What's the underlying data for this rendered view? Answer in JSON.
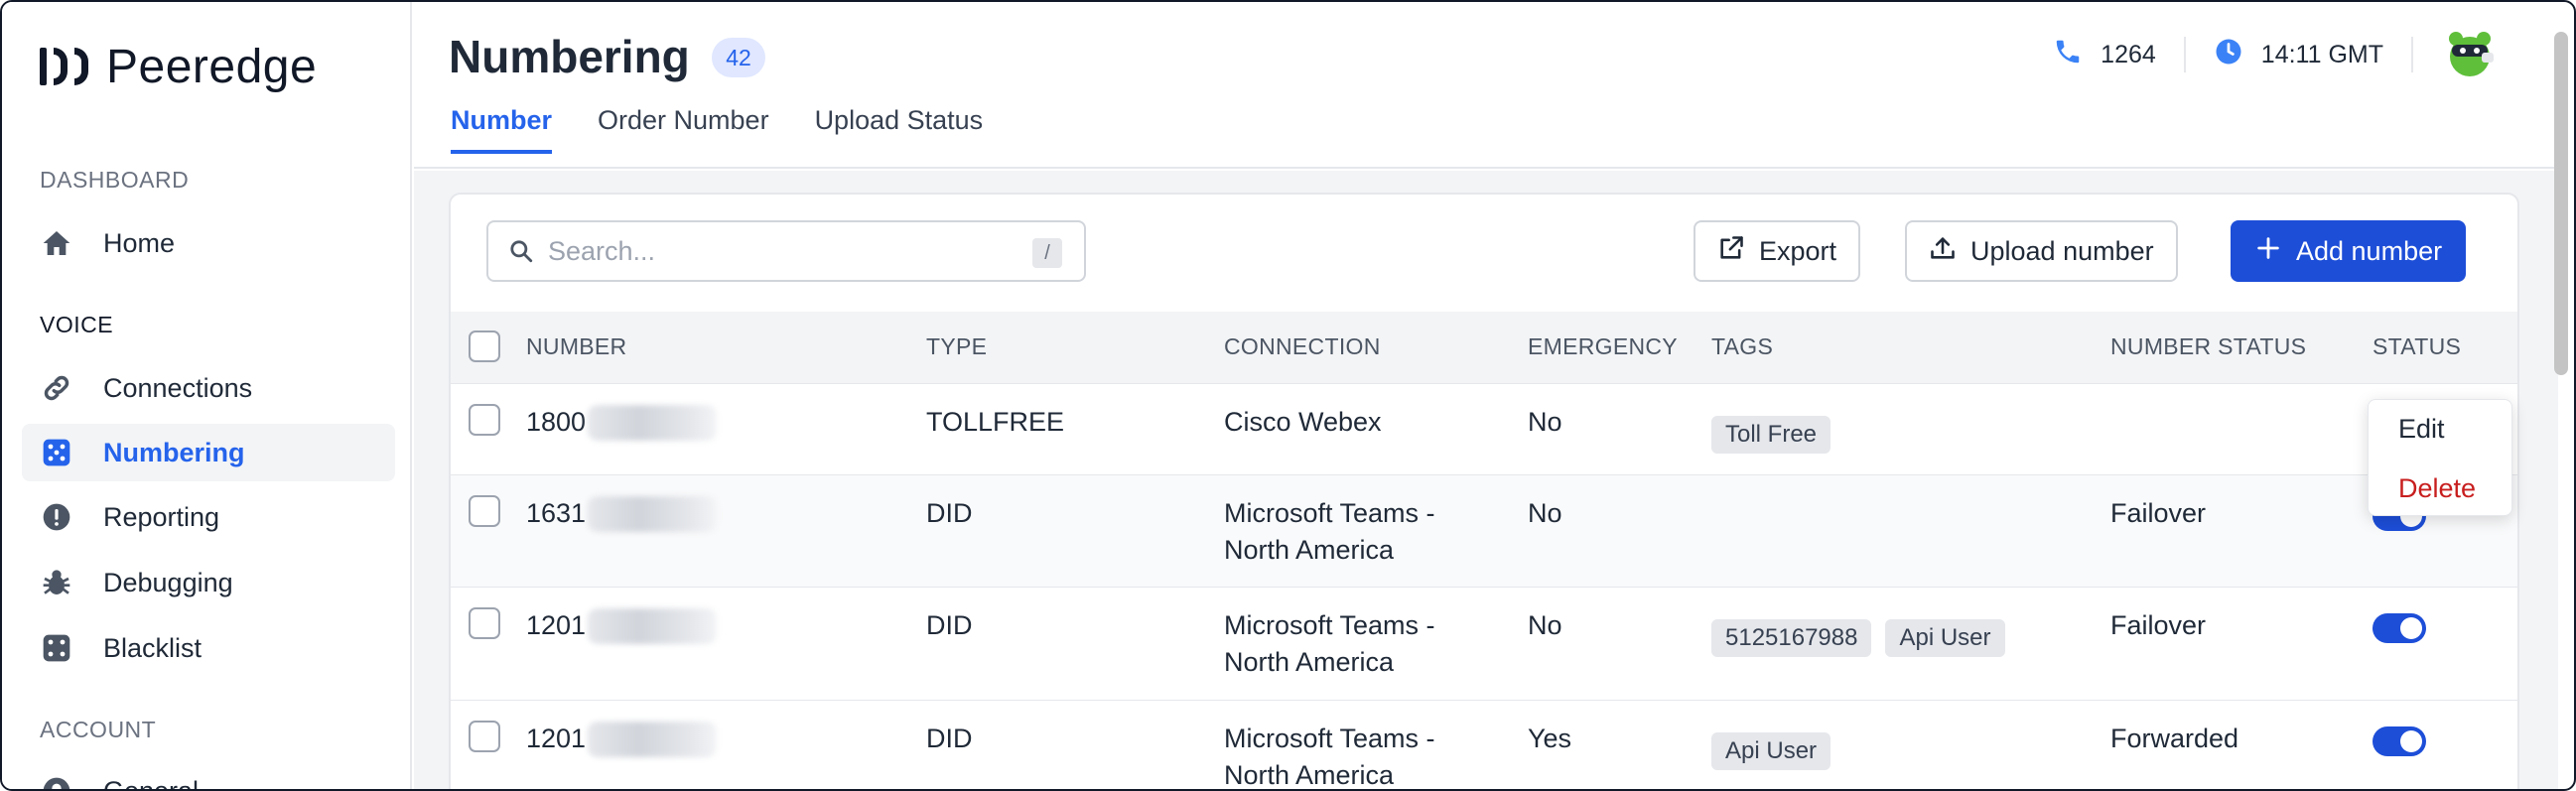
{
  "app": {
    "logo_text": "Peeredge"
  },
  "sidebar": {
    "sections": [
      {
        "label": "DASHBOARD"
      },
      {
        "label": "VOICE"
      },
      {
        "label": "ACCOUNT"
      }
    ],
    "items": [
      {
        "label": "Home",
        "icon": "home-icon"
      },
      {
        "label": "Connections",
        "icon": "link-icon"
      },
      {
        "label": "Numbering",
        "icon": "dice-icon",
        "active": true
      },
      {
        "label": "Reporting",
        "icon": "alert-icon"
      },
      {
        "label": "Debugging",
        "icon": "bug-icon"
      },
      {
        "label": "Blacklist",
        "icon": "dice-icon"
      },
      {
        "label": "General",
        "icon": "user-icon"
      }
    ]
  },
  "header": {
    "title": "Numbering",
    "count": "42",
    "tabs": [
      {
        "label": "Number",
        "active": true
      },
      {
        "label": "Order Number"
      },
      {
        "label": "Upload Status"
      }
    ],
    "phone_count": "1264",
    "time": "14:11 GMT"
  },
  "toolbar": {
    "search_placeholder": "Search...",
    "search_shortcut": "/",
    "export_label": "Export",
    "upload_label": "Upload number",
    "add_label": "Add number"
  },
  "table": {
    "columns": [
      "NUMBER",
      "TYPE",
      "CONNECTION",
      "EMERGENCY",
      "TAGS",
      "NUMBER STATUS",
      "STATUS"
    ],
    "rows": [
      {
        "number_prefix": "1800",
        "type": "TOLLFREE",
        "connection_line1": "Cisco Webex",
        "connection_line2": "",
        "emergency": "No",
        "tags": [
          "Toll Free"
        ],
        "number_status": "",
        "status_on": true
      },
      {
        "number_prefix": "1631",
        "type": "DID",
        "connection_line1": "Microsoft Teams -",
        "connection_line2": "North America",
        "emergency": "No",
        "tags": [],
        "number_status": "Failover",
        "status_on": true
      },
      {
        "number_prefix": "1201",
        "type": "DID",
        "connection_line1": "Microsoft Teams -",
        "connection_line2": "North America",
        "emergency": "No",
        "tags": [
          "5125167988",
          "Api User"
        ],
        "number_status": "Failover",
        "status_on": true
      },
      {
        "number_prefix": "1201",
        "type": "DID",
        "connection_line1": "Microsoft Teams -",
        "connection_line2": "North America",
        "emergency": "Yes",
        "tags": [
          "Api User"
        ],
        "number_status": "Forwarded",
        "status_on": true
      }
    ]
  },
  "row_menu": {
    "edit_label": "Edit",
    "delete_label": "Delete"
  },
  "colors": {
    "accent": "#2563eb",
    "danger": "#c81e1e",
    "toggle": "#1d4ed8"
  }
}
